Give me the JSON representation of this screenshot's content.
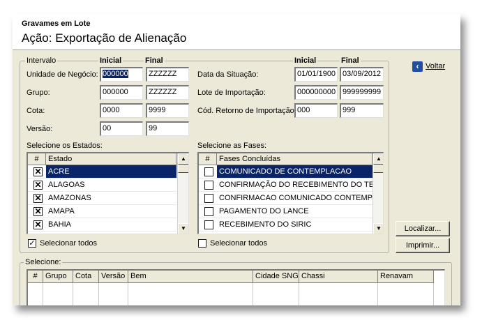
{
  "header": {
    "subtitle": "Gravames em Lote",
    "title": "Ação: Exportação de Alienação"
  },
  "intervalo": {
    "legend": "Intervalo",
    "col_inicial": "Inicial",
    "col_final": "Final",
    "left_fields": [
      {
        "label": "Unidade de Negócio:",
        "inicial": "000000",
        "final": "ZZZZZZ"
      },
      {
        "label": "Grupo:",
        "inicial": "000000",
        "final": "ZZZZZZ"
      },
      {
        "label": "Cota:",
        "inicial": "0000",
        "final": "9999"
      },
      {
        "label": "Versão:",
        "inicial": "00",
        "final": "99"
      }
    ],
    "right_fields": [
      {
        "label": "Data da Situação:",
        "inicial": "01/01/1900",
        "final": "03/09/2012"
      },
      {
        "label": "Lote de Importação:",
        "inicial": "000000000",
        "final": "999999999"
      },
      {
        "label": "Cód. Retorno de Importação:",
        "inicial": "000",
        "final": "999"
      }
    ]
  },
  "estados": {
    "label": "Selecione os Estados:",
    "col_hash": "#",
    "col_name": "Estado",
    "items": [
      {
        "name": "ACRE",
        "checked": true,
        "selected": true
      },
      {
        "name": "ALAGOAS",
        "checked": true,
        "selected": false
      },
      {
        "name": "AMAZONAS",
        "checked": true,
        "selected": false
      },
      {
        "name": "AMAPA",
        "checked": true,
        "selected": false
      },
      {
        "name": "BAHIA",
        "checked": true,
        "selected": false
      }
    ],
    "select_all_label": "Selecionar todos",
    "select_all_checked": true
  },
  "fases": {
    "label": "Selecione as Fases:",
    "col_hash": "#",
    "col_name": "Fases Concluídas",
    "items": [
      {
        "name": "COMUNICADO DE CONTEMPLACAO",
        "checked": false,
        "selected": true
      },
      {
        "name": "CONFIRMAÇÃO DO RECEBIMENTO DO TELEG",
        "checked": false,
        "selected": false
      },
      {
        "name": "CONFIRMACAO COMUNICADO CONTEMPLAC",
        "checked": false,
        "selected": false
      },
      {
        "name": "PAGAMENTO DO LANCE",
        "checked": false,
        "selected": false
      },
      {
        "name": "RECEBIMENTO DO SIRIC",
        "checked": false,
        "selected": false
      }
    ],
    "select_all_label": "Selecionar todos",
    "select_all_checked": false
  },
  "buttons": {
    "voltar": "Voltar",
    "localizar": "Localizar...",
    "imprimir": "Imprimir..."
  },
  "selecione": {
    "legend": "Selecione:",
    "columns": [
      "#",
      "Grupo",
      "Cota",
      "Versão",
      "Bem",
      "Cidade SNG",
      "Chassi",
      "Renavam"
    ]
  },
  "colors": {
    "selection": "#0a246a",
    "window_bg": "#ece9d8",
    "voltar_icon": "#1f4fa0"
  }
}
